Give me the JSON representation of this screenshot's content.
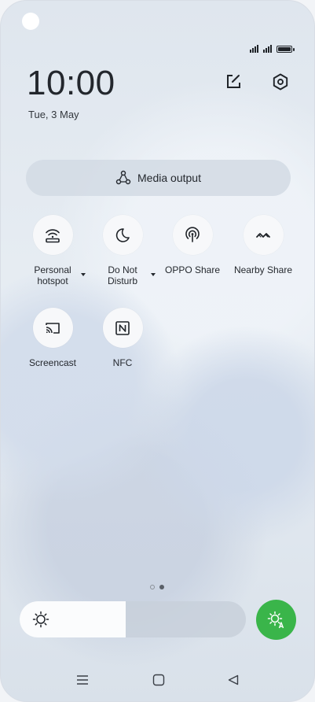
{
  "status": {
    "time": "10:00",
    "date": "Tue, 3 May",
    "battery_level": 1.0,
    "signal_bars": 4
  },
  "header": {
    "edit_icon": "edit-square-icon",
    "settings_icon": "settings-gear-icon"
  },
  "media_output": {
    "label": "Media output",
    "icon": "media-output-icon"
  },
  "tiles": [
    {
      "label": "Personal\nhotspot",
      "icon": "hotspot-icon",
      "has_menu": true
    },
    {
      "label": "Do Not\nDisturb",
      "icon": "moon-icon",
      "has_menu": true
    },
    {
      "label": "OPPO Share",
      "icon": "oppo-share-icon",
      "has_menu": false
    },
    {
      "label": "Nearby Share",
      "icon": "nearby-share-icon",
      "has_menu": false
    },
    {
      "label": "Screencast",
      "icon": "screencast-icon",
      "has_menu": false
    },
    {
      "label": "NFC",
      "icon": "nfc-icon",
      "has_menu": false
    }
  ],
  "pager": {
    "pages": 2,
    "current": 2
  },
  "brightness": {
    "level": 0.47,
    "icon": "sun-icon",
    "auto_icon": "auto-brightness-icon",
    "auto_color": "#3ab54a",
    "auto_enabled": true
  },
  "nav": {
    "menu_icon": "menu-lines-icon",
    "home_icon": "home-square-icon",
    "back_icon": "back-triangle-icon"
  }
}
